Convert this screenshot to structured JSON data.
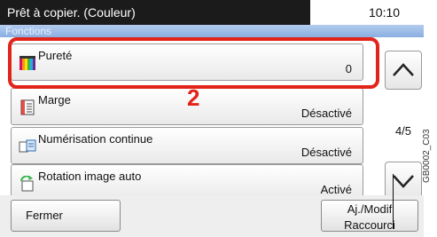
{
  "header": {
    "status": "Prêt à copier. (Couleur)",
    "time": "10:10",
    "subtitle": "Fonctions"
  },
  "rows": [
    {
      "label": "Pureté",
      "value": "0",
      "icon": "color-purity-icon"
    },
    {
      "label": "Marge",
      "value": "Désactivé",
      "icon": "margin-icon"
    },
    {
      "label": "Numérisation continue",
      "value": "Désactivé",
      "icon": "continuous-scan-icon"
    },
    {
      "label": "Rotation image auto",
      "value": "Activé",
      "icon": "auto-rotate-icon"
    }
  ],
  "pager": {
    "page": "4/5"
  },
  "callout": "2",
  "footer": {
    "close": "Fermer",
    "shortcut_line1": "Aj./Modif",
    "shortcut_line2": "Raccourci"
  },
  "figure_code": "GB0002_C03",
  "colors": {
    "highlight": "#e2231a",
    "header": "#1b1b1b"
  }
}
